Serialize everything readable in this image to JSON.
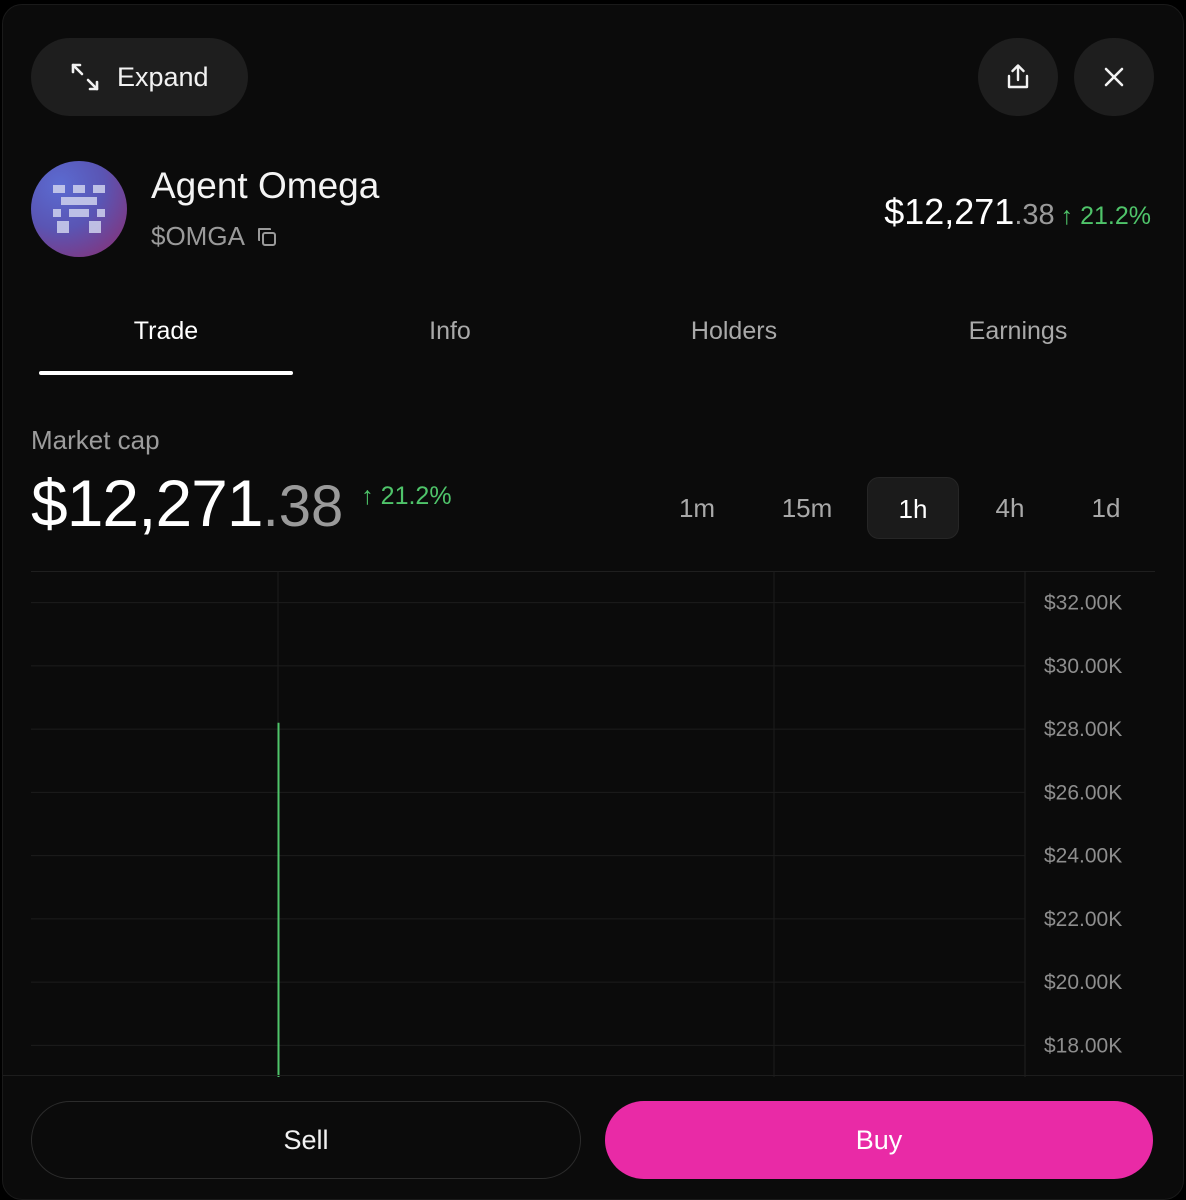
{
  "header": {
    "expand_label": "Expand",
    "share_icon": "share-icon",
    "close_icon": "close-icon"
  },
  "token": {
    "name": "Agent Omega",
    "ticker": "$OMGA",
    "price_main": "$12,271",
    "price_cents": ".38",
    "change": "↑ 21.2%"
  },
  "tabs": [
    {
      "label": "Trade",
      "active": true
    },
    {
      "label": "Info",
      "active": false
    },
    {
      "label": "Holders",
      "active": false
    },
    {
      "label": "Earnings",
      "active": false
    }
  ],
  "market_cap": {
    "label": "Market cap",
    "value_main": "$12,271",
    "value_cents": ".38",
    "change": "↑ 21.2%"
  },
  "timeframes": [
    {
      "label": "1m",
      "active": false
    },
    {
      "label": "15m",
      "active": false
    },
    {
      "label": "1h",
      "active": true
    },
    {
      "label": "4h",
      "active": false
    },
    {
      "label": "1d",
      "active": false
    }
  ],
  "colors": {
    "up": "#4fc46a",
    "buy": "#e92aa6",
    "background": "#0b0b0b"
  },
  "chart_data": {
    "type": "line",
    "y_tick_labels": [
      "$32.00K",
      "$30.00K",
      "$28.00K",
      "$26.00K",
      "$24.00K",
      "$22.00K",
      "$20.00K",
      "$18.00K"
    ],
    "ylim": [
      17000,
      33000
    ],
    "candle": {
      "high": 28200,
      "low": 17000
    },
    "grid": true
  },
  "actions": {
    "sell_label": "Sell",
    "buy_label": "Buy"
  }
}
